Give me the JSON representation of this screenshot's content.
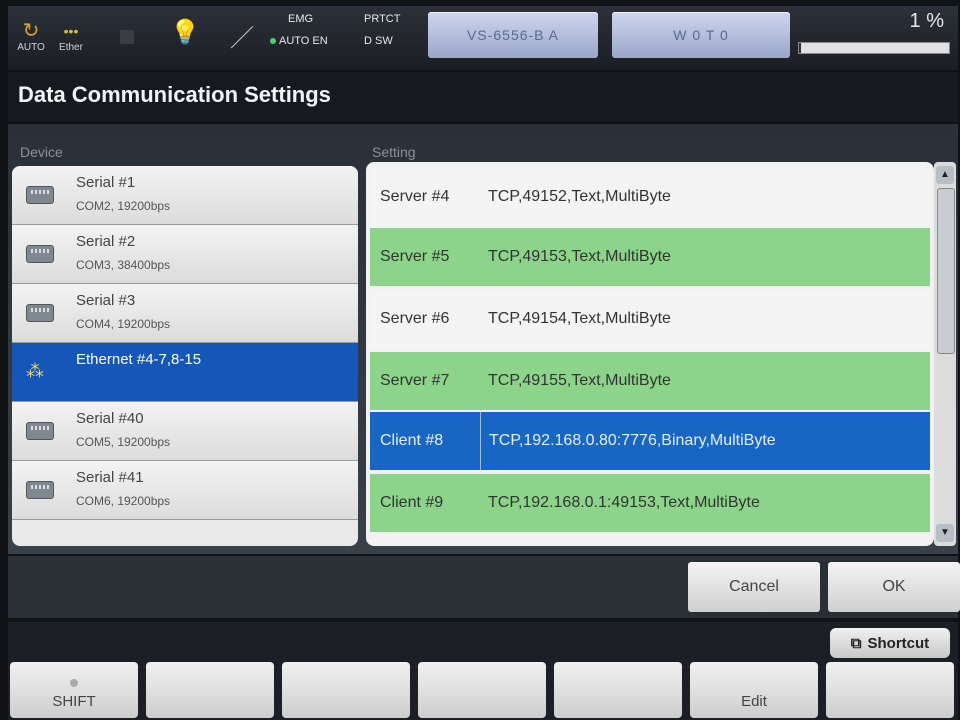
{
  "status": {
    "auto_label": "AUTO",
    "ether_label": "Ether",
    "emg_label": "EMG",
    "auto_en_label": "AUTO EN",
    "prtct_label": "PRTCT",
    "dsw_label": "D SW",
    "btn1_label": "VS-6556-B A",
    "btn2_label": "W 0 T 0",
    "progress_text": "1 %",
    "progress_value": 0.01
  },
  "title": "Data Communication Settings",
  "device_header": "Device",
  "setting_header": "Setting",
  "devices": [
    {
      "name": "Serial #1",
      "sub": "COM2, 19200bps",
      "icon": "serial-port-icon"
    },
    {
      "name": "Serial #2",
      "sub": "COM3, 38400bps",
      "icon": "serial-port-icon"
    },
    {
      "name": "Serial #3",
      "sub": "COM4, 19200bps",
      "icon": "serial-port-icon"
    },
    {
      "name": "Ethernet #4-7,8-15",
      "sub": "",
      "icon": "network-icon"
    },
    {
      "name": "Serial #40",
      "sub": "COM5, 19200bps",
      "icon": "serial-port-icon"
    },
    {
      "name": "Serial #41",
      "sub": "COM6, 19200bps",
      "icon": "serial-port-icon"
    }
  ],
  "settings": [
    {
      "name": "Server #4",
      "value": "TCP,49152,Text,MultiByte"
    },
    {
      "name": "Server #5",
      "value": "TCP,49153,Text,MultiByte"
    },
    {
      "name": "Server #6",
      "value": "TCP,49154,Text,MultiByte"
    },
    {
      "name": "Server #7",
      "value": "TCP,49155,Text,MultiByte"
    },
    {
      "name": "Client #8",
      "value": "TCP,192.168.0.80:7776,Binary,MultiByte"
    },
    {
      "name": "Client #9",
      "value": "TCP,192.168.0.1:49153,Text,MultiByte"
    }
  ],
  "buttons": {
    "cancel": "Cancel",
    "ok": "OK"
  },
  "shortcut_label": "Shortcut",
  "fkeys": [
    "SHIFT",
    "",
    "",
    "",
    "",
    "Edit",
    ""
  ]
}
